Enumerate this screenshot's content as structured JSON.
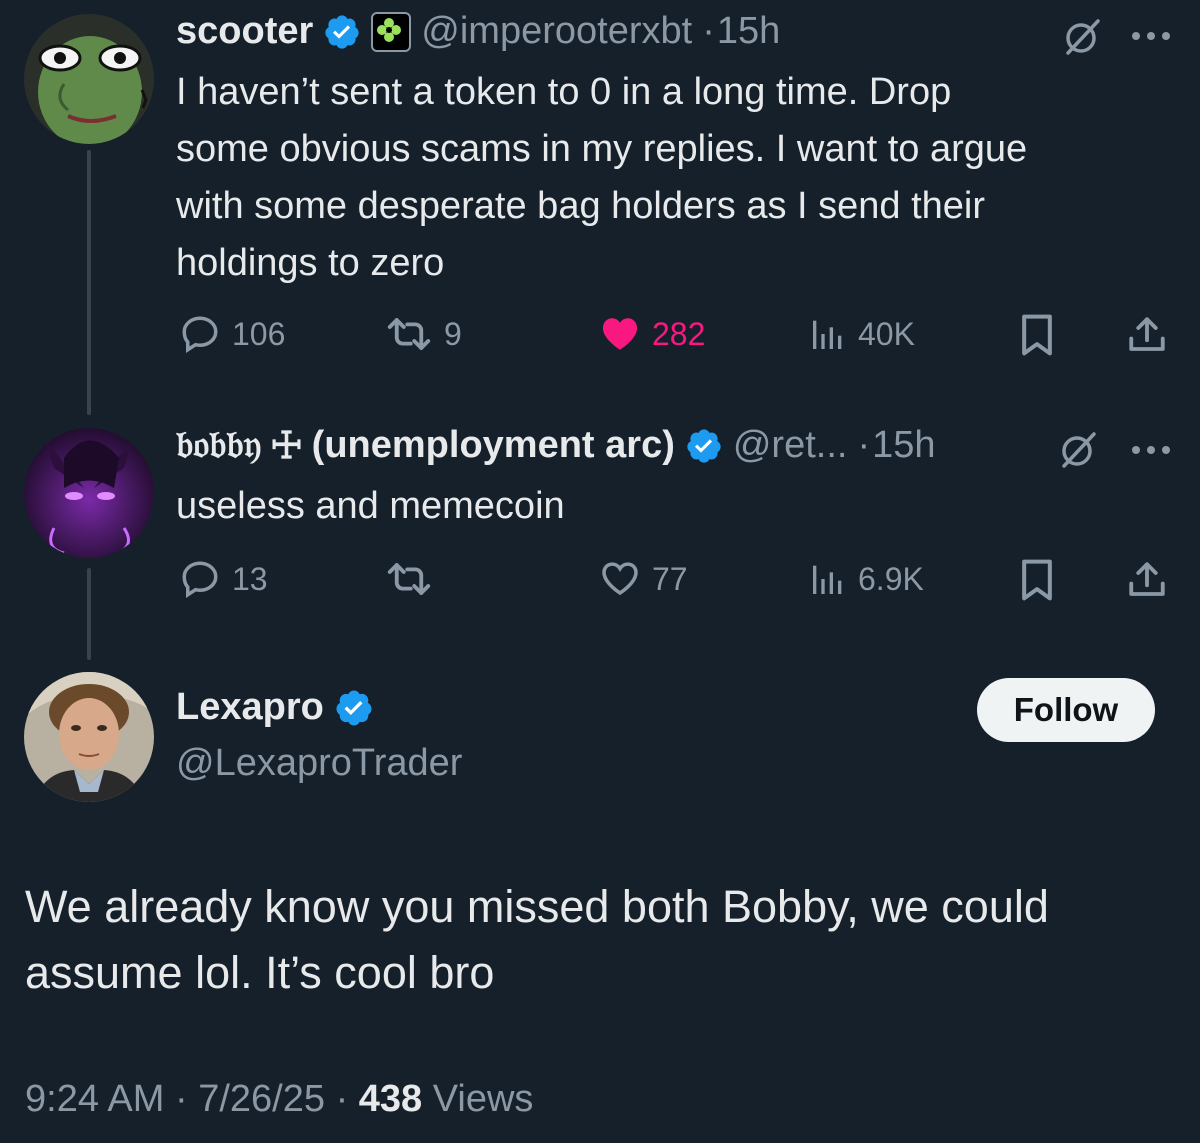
{
  "tweet1": {
    "name": "scooter",
    "handle": "@imperooterxbt",
    "time": "15h",
    "text_lines": [
      "I haven’t sent a token to 0 in a long time. Drop",
      "some obvious scams in my replies. I want to argue",
      "with some desperate bag holders as I send their",
      "holdings to zero"
    ],
    "replies": "106",
    "reposts": "9",
    "likes": "282",
    "views": "40K",
    "like_color": "#f91880"
  },
  "tweet2": {
    "name": "𝔟𝔬𝔟𝔟𝔶 ☩ (unemployment arc)",
    "handle": "@ret...",
    "time": "15h",
    "text": "useless and memecoin",
    "replies": "13",
    "reposts": "",
    "likes": "77",
    "views": "6.9K"
  },
  "tweet3": {
    "name": "Lexapro",
    "handle": "@LexaproTrader",
    "follow_label": "Follow",
    "text_lines": [
      "We already know you missed both Bobby, we could",
      "assume lol. It’s cool bro"
    ],
    "time": "9:24 AM",
    "date": "7/26/25",
    "views_count": "438",
    "views_label": "Views"
  },
  "colors": {
    "background": "#15202b",
    "verified": "#1d9bf0",
    "muted": "#8b98a5"
  }
}
